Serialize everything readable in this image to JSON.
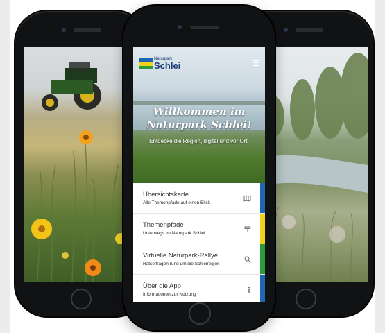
{
  "app": {
    "logo": {
      "small": "Naturpark",
      "big": "Schlei"
    },
    "hero": {
      "title_line1": "Willkommen im",
      "title_line2": "Naturpark Schlei!",
      "subtitle": "Entdecke die Region, digital und vor Ort."
    },
    "menu": [
      {
        "title": "Übersichtskarte",
        "subtitle": "Alle Themenpfade auf einen Blick",
        "icon": "map-icon",
        "bar_color": "#1d67b3"
      },
      {
        "title": "Themenpfade",
        "subtitle": "Unterwegs im Naturpark Schlei",
        "icon": "signpost-icon",
        "bar_color": "#f4d21a"
      },
      {
        "title": "Virtuelle Naturpark-Rallye",
        "subtitle": "Rätselfragen rund um die Schleiregion",
        "icon": "search-icon",
        "bar_color": "#2f9a3c"
      },
      {
        "title": "Über die App",
        "subtitle": "Informationen zur Nutzung",
        "icon": "info-icon",
        "bar_color": "#1d67b3"
      }
    ]
  },
  "colors": {
    "brand_blue": "#1d67b3",
    "brand_yellow": "#f4d21a",
    "brand_green": "#2f9a3c",
    "phone_frame": "#111214"
  }
}
